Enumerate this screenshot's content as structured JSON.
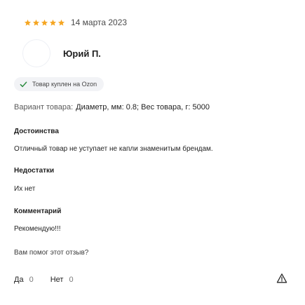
{
  "review": {
    "rating": 5,
    "star_color": "#f5a623",
    "date": "14 марта 2023",
    "author_name": "Юрий П.",
    "verified_text": "Товар куплен на Ozon",
    "variant_label": "Вариант товара:",
    "variant_value": "Диаметр, мм: 0.8; Вес товара, г: 5000",
    "sections": {
      "pros_title": "Достоинства",
      "pros_text": "Отличный товар не уступает не капли знаменитым брендам.",
      "cons_title": "Недостатки",
      "cons_text": "Их нет",
      "comment_title": "Комментарий",
      "comment_text": "Рекомендую!!!"
    },
    "helpful_question": "Вам помог этот отзыв?",
    "votes": {
      "yes_label": "Да",
      "yes_count": "0",
      "no_label": "Нет",
      "no_count": "0"
    },
    "icons": {
      "check": "check-icon",
      "report": "alert-triangle-icon"
    }
  }
}
